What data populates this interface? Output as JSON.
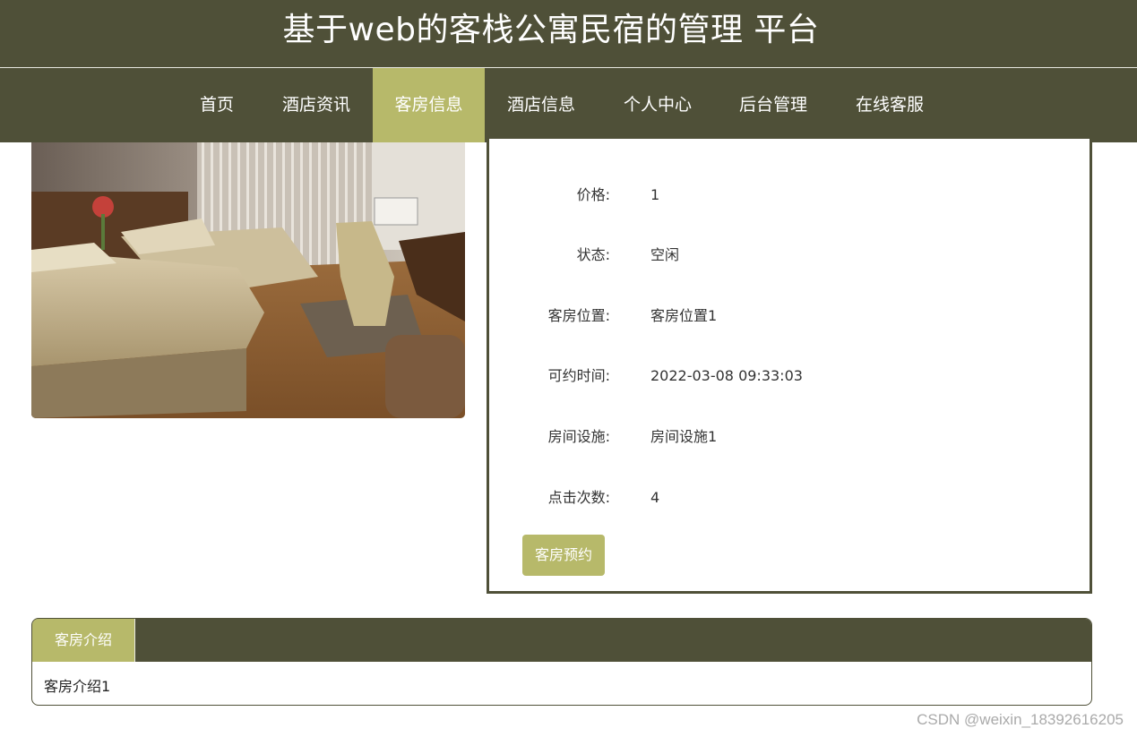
{
  "header": {
    "title": "基于web的客栈公寓民宿的管理 平台"
  },
  "nav": {
    "items": [
      {
        "label": "首页",
        "active": false
      },
      {
        "label": "酒店资讯",
        "active": false
      },
      {
        "label": "客房信息",
        "active": true
      },
      {
        "label": "酒店信息",
        "active": false
      },
      {
        "label": "个人中心",
        "active": false
      },
      {
        "label": "后台管理",
        "active": false
      },
      {
        "label": "在线客服",
        "active": false
      }
    ]
  },
  "details": {
    "rows": [
      {
        "label": "价格:",
        "value": "1"
      },
      {
        "label": "状态:",
        "value": "空闲"
      },
      {
        "label": "客房位置:",
        "value": "客房位置1"
      },
      {
        "label": "可约时间:",
        "value": "2022-03-08 09:33:03"
      },
      {
        "label": "房间设施:",
        "value": "房间设施1"
      },
      {
        "label": "点击次数:",
        "value": "4"
      }
    ],
    "book_button": "客房预约"
  },
  "intro": {
    "tab_label": "客房介绍",
    "content": "客房介绍1"
  },
  "watermark": "CSDN @weixin_18392616205",
  "colors": {
    "primary": "#4f5038",
    "accent": "#b7b96a"
  }
}
